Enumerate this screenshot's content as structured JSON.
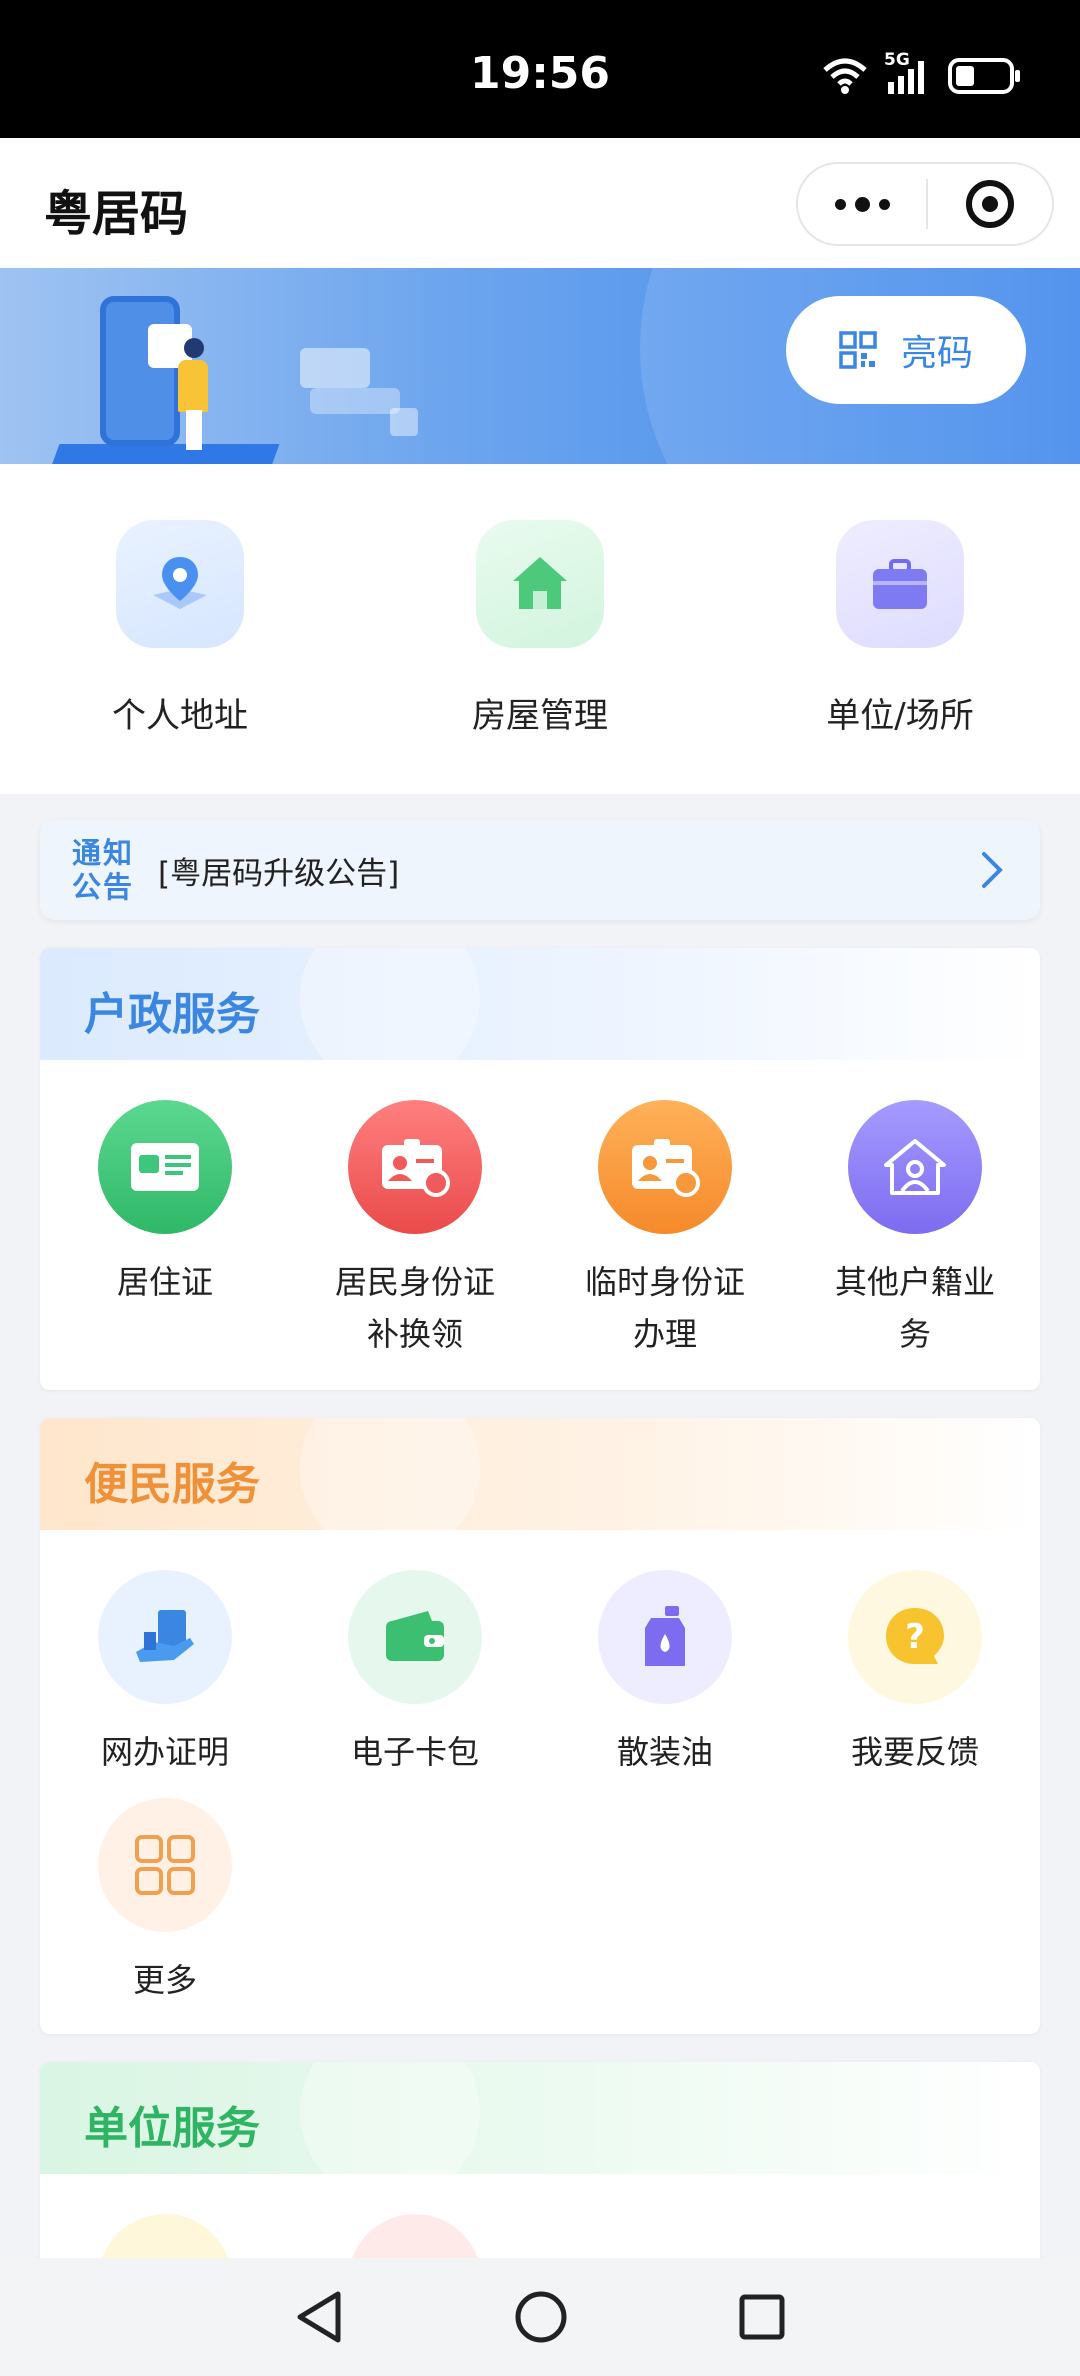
{
  "status_bar": {
    "time": "19:56",
    "network": "5G"
  },
  "app": {
    "title": "粤居码"
  },
  "capsule": {
    "more_icon": "more-dots-icon",
    "close_icon": "target-close-icon"
  },
  "banner": {
    "show_code_label": "亮码"
  },
  "quick_menu": [
    {
      "label": "个人地址",
      "icon": "location-pin-icon",
      "color": "#4a90f0"
    },
    {
      "label": "房屋管理",
      "icon": "house-icon",
      "color": "#4cc97a"
    },
    {
      "label": "单位/场所",
      "icon": "briefcase-icon",
      "color": "#6f6cf0"
    }
  ],
  "notice": {
    "tag_line1": "通知",
    "tag_line2": "公告",
    "text": "[粤居码升级公告]"
  },
  "sections": {
    "household": {
      "title": "户政服务",
      "title_color": "#3a86e0",
      "items": [
        {
          "line1": "居住证",
          "line2": "",
          "icon": "residence-card-icon",
          "color": "#3dc77c"
        },
        {
          "line1": "居民身份证",
          "line2": "补换领",
          "icon": "id-card-renew-icon",
          "color": "#f05a5a"
        },
        {
          "line1": "临时身份证",
          "line2": "办理",
          "icon": "temp-id-card-icon",
          "color": "#f7983a"
        },
        {
          "line1": "其他户籍业",
          "line2": "务",
          "icon": "household-house-icon",
          "color": "#8a7cf0"
        }
      ]
    },
    "convenience": {
      "title": "便民服务",
      "title_color": "#f0913a",
      "items": [
        {
          "label": "网办证明",
          "icon": "certificate-hand-icon",
          "color": "#3a86e0"
        },
        {
          "label": "电子卡包",
          "icon": "wallet-icon",
          "color": "#3dbf72"
        },
        {
          "label": "散装油",
          "icon": "oil-bottle-icon",
          "color": "#7d6cf0"
        },
        {
          "label": "我要反馈",
          "icon": "question-bubble-icon",
          "color": "#f7c430"
        },
        {
          "label": "更多",
          "icon": "grid-more-icon",
          "color": "#f0a050"
        }
      ]
    },
    "unit": {
      "title": "单位服务",
      "title_color": "#2fb463"
    }
  },
  "nav": {
    "back": "back-triangle-icon",
    "home": "home-circle-icon",
    "recents": "recents-square-icon"
  }
}
